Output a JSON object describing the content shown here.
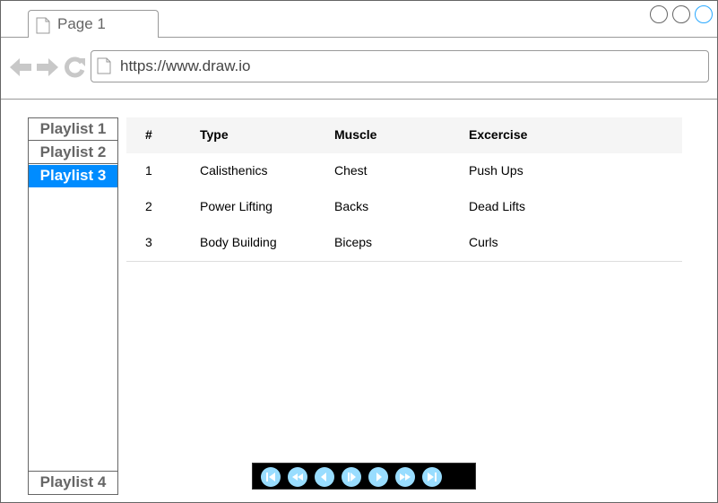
{
  "browser": {
    "tab_title": "Page 1",
    "url": "https://www.draw.io",
    "icons": [
      "page-icon",
      "back-arrow-icon",
      "forward-arrow-icon",
      "refresh-icon"
    ],
    "window_controls": [
      "minimize",
      "maximize",
      "close"
    ],
    "accent_color": "#29a8ff"
  },
  "sidebar": {
    "items": [
      {
        "label": "Playlist 1",
        "active": false
      },
      {
        "label": "Playlist 2",
        "active": false
      },
      {
        "label": "Playlist 3",
        "active": true
      }
    ],
    "bottom_item": {
      "label": "Playlist 4"
    },
    "active_color": "#008cff"
  },
  "table": {
    "headers": [
      "#",
      "Type",
      "Muscle",
      "Excercise"
    ],
    "rows": [
      [
        "1",
        "Calisthenics",
        "Chest",
        "Push Ups"
      ],
      [
        "2",
        "Power Lifting",
        "Backs",
        "Dead Lifts"
      ],
      [
        "3",
        "Body Building",
        "Biceps",
        "Curls"
      ]
    ]
  },
  "player": {
    "buttons": [
      "skip-to-start",
      "rewind",
      "previous",
      "play",
      "next",
      "fast-forward",
      "skip-to-end"
    ]
  }
}
